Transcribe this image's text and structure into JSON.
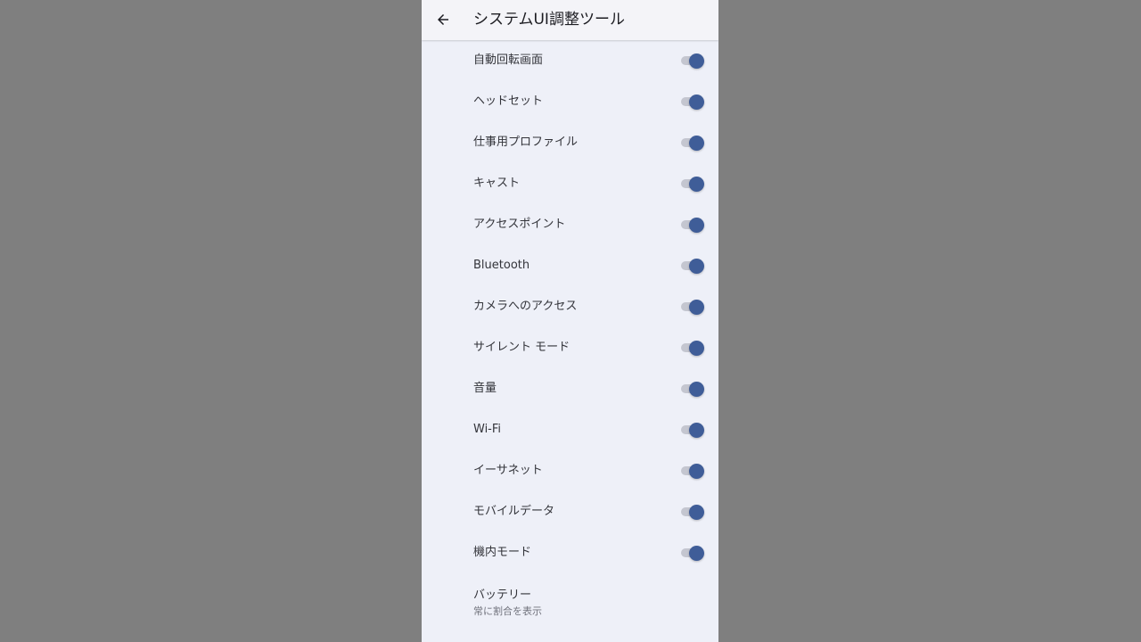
{
  "header": {
    "title": "システムUI調整ツール",
    "back_icon": "arrow-left-icon"
  },
  "colors": {
    "switch_thumb_on": "#3f5d98",
    "switch_track": "#c4c6d0",
    "screen_background": "#eef0f8"
  },
  "items": [
    {
      "label": "自動回転画面",
      "on": true
    },
    {
      "label": "ヘッドセット",
      "on": true
    },
    {
      "label": "仕事用プロファイル",
      "on": true
    },
    {
      "label": "キャスト",
      "on": true
    },
    {
      "label": "アクセスポイント",
      "on": true
    },
    {
      "label": "Bluetooth",
      "on": true
    },
    {
      "label": "カメラへのアクセス",
      "on": true
    },
    {
      "label": "サイレント モード",
      "on": true
    },
    {
      "label": "音量",
      "on": true
    },
    {
      "label": "Wi-Fi",
      "on": true
    },
    {
      "label": "イーサネット",
      "on": true
    },
    {
      "label": "モバイルデータ",
      "on": true
    },
    {
      "label": "機内モード",
      "on": true
    }
  ],
  "battery": {
    "label": "バッテリー",
    "summary": "常に割合を表示"
  }
}
